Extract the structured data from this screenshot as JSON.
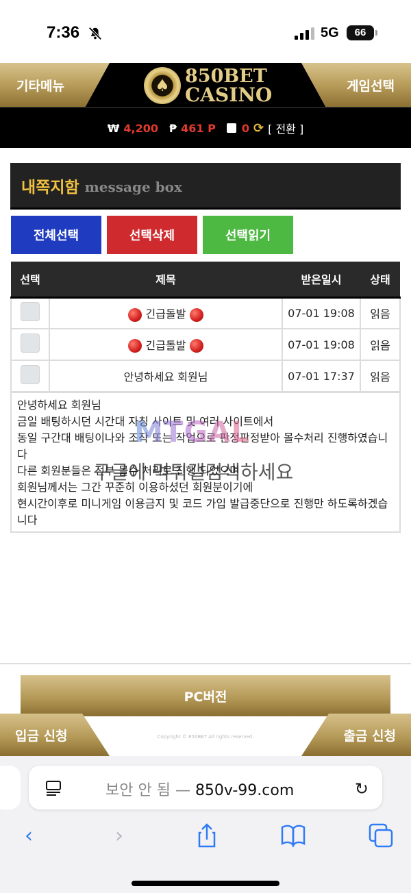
{
  "status_bar": {
    "time": "7:36",
    "network": "5G",
    "battery": "66"
  },
  "header": {
    "left_menu": "기타메뉴",
    "right_menu": "게임선택",
    "logo_line1": "850BET",
    "logo_line2": "CASINO"
  },
  "balance": {
    "won_symbol": "₩",
    "won_amount": "4,200",
    "point_symbol": "₱",
    "point_amount": "461 P",
    "chip_amount": "0",
    "convert_label": "[ 전환 ]"
  },
  "message_box": {
    "title_kr": "내쪽지함",
    "title_en": "message box"
  },
  "actions": {
    "select_all": "전체선택",
    "delete_selected": "선택삭제",
    "read_selected": "선택읽기"
  },
  "table": {
    "headers": [
      "선택",
      "제목",
      "받은일시",
      "상태"
    ],
    "rows": [
      {
        "title": "긴급돌발",
        "date": "07-01 19:08",
        "status": "읽음",
        "flag": true
      },
      {
        "title": "긴급돌발",
        "date": "07-01 19:08",
        "status": "읽음",
        "flag": true
      },
      {
        "title": "안녕하세요 회원님",
        "date": "07-01 17:37",
        "status": "읽음",
        "flag": false
      }
    ]
  },
  "message_body": [
    "안녕하세요 회원님",
    "금일 배팅하시던 시간대 자칭 사이트 및 여러 사이트에서",
    "동일 구간대 배팅이나와 조작 또는 작업으로 판정판정받아 몰수처리 진행하였습니다",
    "다른 회원분들은 전부 몰수 처리로 진행 되었으며",
    "회원님께서는 그간 꾸준히 이용하셨던 회원분이기에",
    "현시간이후로 미니게임 이용금지 및 코드 가입 발급중단으로 진행만 하도록하겠습니다"
  ],
  "watermark": {
    "logo": "MTGAL",
    "text": "구글에 먹튀갤검색하세요"
  },
  "footer": {
    "pc_version": "PC버전",
    "deposit": "입금 신청",
    "withdraw": "출금 신청",
    "copyright": "Copyright © 850BET All rights reserved."
  },
  "browser": {
    "url_prefix": "보안 안 됨 — ",
    "url": "850v-99.com"
  }
}
